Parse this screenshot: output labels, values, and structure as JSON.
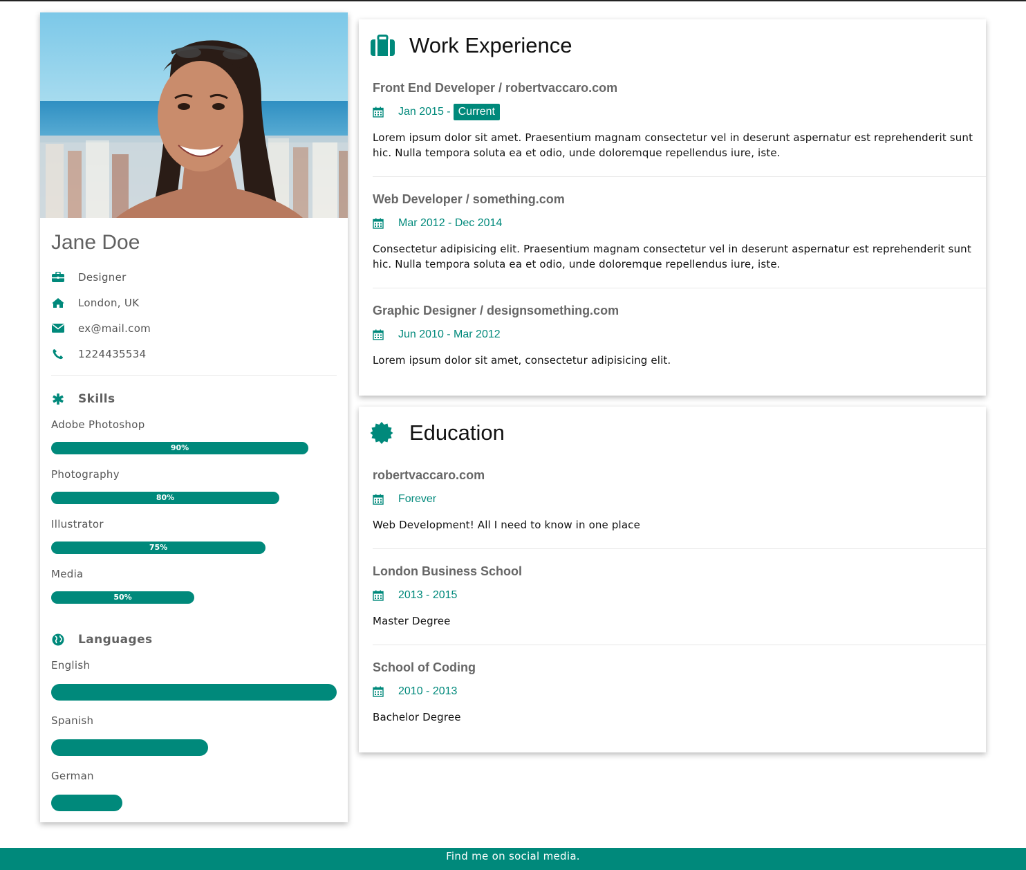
{
  "profile": {
    "name": "Jane Doe",
    "photo_alt": "",
    "info": [
      {
        "icon": "briefcase-icon",
        "text": "Designer"
      },
      {
        "icon": "home-icon",
        "text": "London, UK"
      },
      {
        "icon": "envelope-icon",
        "text": "ex@mail.com"
      },
      {
        "icon": "phone-icon",
        "text": "1224435534"
      }
    ]
  },
  "skills": {
    "title": "Skills",
    "icon": "asterisk-icon",
    "items": [
      {
        "name": "Adobe Photoshop",
        "percent": 90,
        "label": "90%"
      },
      {
        "name": "Photography",
        "percent": 80,
        "label": "80%"
      },
      {
        "name": "Illustrator",
        "percent": 75,
        "label": "75%"
      },
      {
        "name": "Media",
        "percent": 50,
        "label": "50%"
      }
    ]
  },
  "languages": {
    "title": "Languages",
    "icon": "globe-icon",
    "items": [
      {
        "name": "English",
        "percent": 100
      },
      {
        "name": "Spanish",
        "percent": 55
      },
      {
        "name": "German",
        "percent": 25
      }
    ]
  },
  "work": {
    "title": "Work Experience",
    "icon": "suitcase-icon",
    "entries": [
      {
        "title": "Front End Developer / robertvaccaro.com",
        "date": "Jan 2015 -",
        "badge": "Current",
        "desc": "Lorem ipsum dolor sit amet. Praesentium magnam consectetur vel in deserunt aspernatur est reprehenderit sunt hic. Nulla tempora soluta ea et odio, unde doloremque repellendus iure, iste."
      },
      {
        "title": "Web Developer / something.com",
        "date": "Mar 2012 - Dec 2014",
        "desc": "Consectetur adipisicing elit. Praesentium magnam consectetur vel in deserunt aspernatur est reprehenderit sunt hic. Nulla tempora soluta ea et odio, unde doloremque repellendus iure, iste."
      },
      {
        "title": "Graphic Designer / designsomething.com",
        "date": "Jun 2010 - Mar 2012",
        "desc": "Lorem ipsum dolor sit amet, consectetur adipisicing elit."
      }
    ]
  },
  "education": {
    "title": "Education",
    "icon": "certificate-icon",
    "entries": [
      {
        "title": "robertvaccaro.com",
        "date": "Forever",
        "desc": "Web Development! All I need to know in one place"
      },
      {
        "title": "London Business School",
        "date": "2013 - 2015",
        "desc": "Master Degree"
      },
      {
        "title": "School of Coding",
        "date": "2010 - 2013",
        "desc": "Bachelor Degree"
      }
    ]
  },
  "footer": {
    "text": "Find me on social media."
  },
  "colors": {
    "accent": "#00897b",
    "title_gray": "#616161"
  }
}
